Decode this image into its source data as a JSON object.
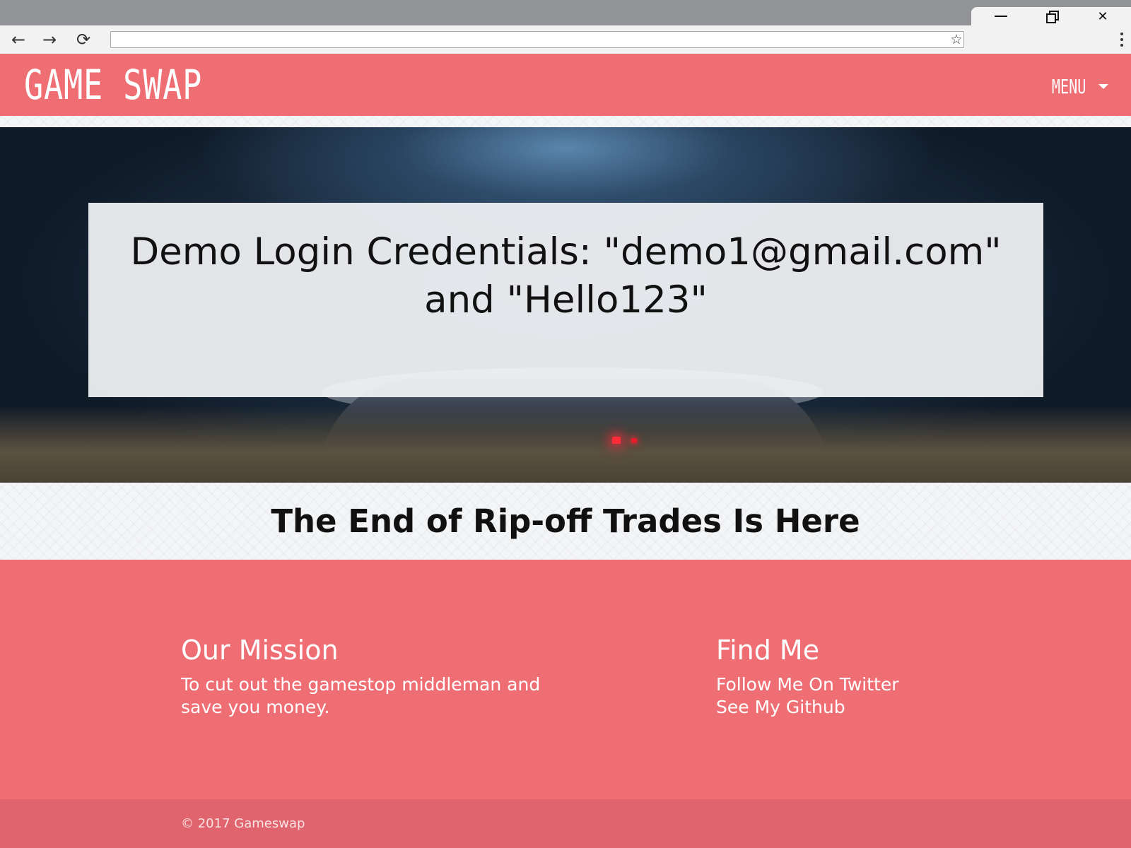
{
  "browser": {
    "address_value": "",
    "back_glyph": "←",
    "forward_glyph": "→",
    "reload_glyph": "⟳",
    "star_glyph": "☆",
    "close_glyph": "✕"
  },
  "header": {
    "logo": "GAME SWAP",
    "menu_label": "MENU"
  },
  "hero": {
    "credentials_line1": "Demo Login Credentials: \"demo1@gmail.com\"",
    "credentials_line2": "and \"Hello123\""
  },
  "tagline": "The End of Rip-off Trades Is Here",
  "footer": {
    "mission_heading": "Our Mission",
    "mission_text": "To cut out the gamestop middleman and save you money.",
    "find_heading": "Find Me",
    "twitter_link": "Follow Me On Twitter",
    "github_link": "See My Github",
    "copyright": "© 2017 Gameswap"
  },
  "colors": {
    "brand": "#ef6e73",
    "copyright_bar": "#e0646e"
  },
  "icons": [
    "back-icon",
    "forward-icon",
    "reload-icon",
    "star-icon",
    "kebab-menu-icon",
    "minimize-icon",
    "maximize-icon",
    "close-icon",
    "caret-down-icon"
  ]
}
